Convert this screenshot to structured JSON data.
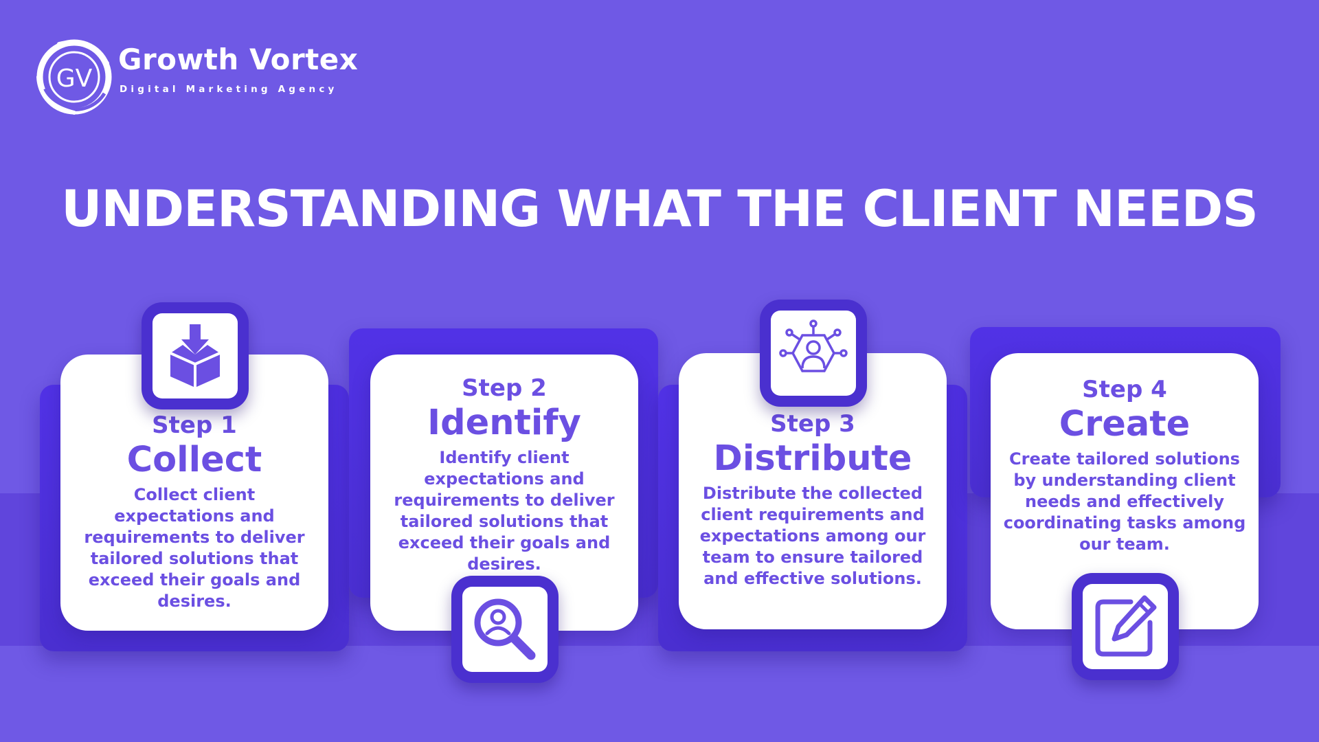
{
  "brand": {
    "name": "Growth Vortex",
    "tagline": "Digital Marketing Agency",
    "monogram": "GV"
  },
  "title": "UNDERSTANDING WHAT THE CLIENT NEEDS",
  "colors": {
    "background": "#6f59e5",
    "accent": "#6b4fe2",
    "tile": "#4a30cf",
    "card": "#ffffff"
  },
  "steps": [
    {
      "label": "Step 1",
      "name": "Collect",
      "description": "Collect client expectations and requirements to deliver tailored solutions that exceed their goals and desires.",
      "icon": "download-box-icon"
    },
    {
      "label": "Step 2",
      "name": "Identify",
      "description": "Identify client expectations and requirements to deliver tailored solutions that exceed their goals and desires.",
      "icon": "user-search-icon"
    },
    {
      "label": "Step 3",
      "name": "Distribute",
      "description": "Distribute the collected client requirements and expectations among our team to ensure tailored and effective solutions.",
      "icon": "user-network-icon"
    },
    {
      "label": "Step 4",
      "name": "Create",
      "description": "Create tailored solutions by understanding client needs and effectively coordinating tasks among our team.",
      "icon": "edit-pencil-icon"
    }
  ]
}
